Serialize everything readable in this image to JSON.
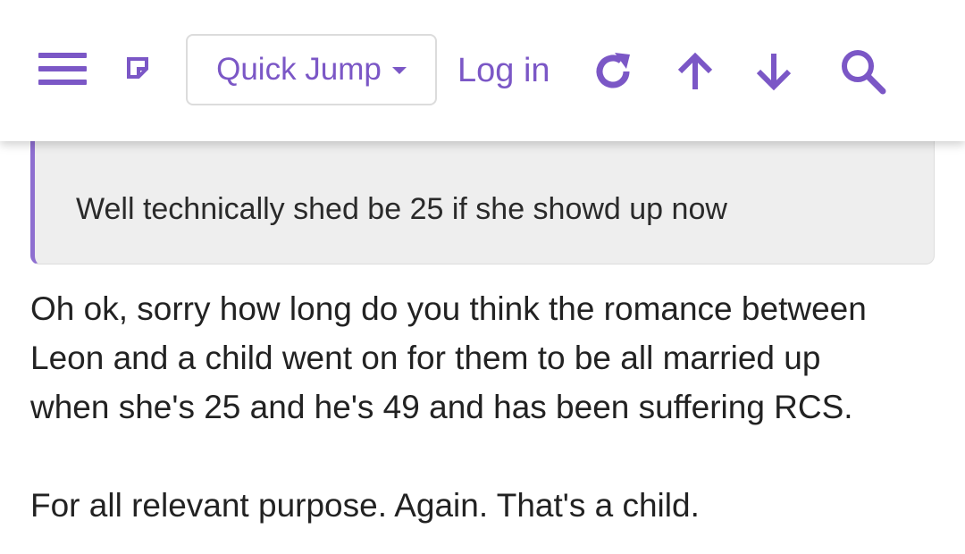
{
  "header": {
    "quick_jump_label": "Quick Jump",
    "login_label": "Log in",
    "icons": [
      "menu-icon",
      "new-posts-icon",
      "refresh-icon",
      "arrow-up-icon",
      "arrow-down-icon",
      "search-icon"
    ],
    "accent_color": "#7b57c6"
  },
  "quote": {
    "text": "Well technically shed be 25 if she showd up now",
    "border_color": "#8e6fd0"
  },
  "post": {
    "paragraph_1_line_1": "Oh ok, sorry how long do you think the romance between",
    "paragraph_1_line_2": "Leon and a child went on for them to be all married up",
    "paragraph_1_line_3": "when she's 25 and he's 49 and has been suffering RCS.",
    "paragraph_2": "For all relevant purpose. Again. That's a child."
  }
}
